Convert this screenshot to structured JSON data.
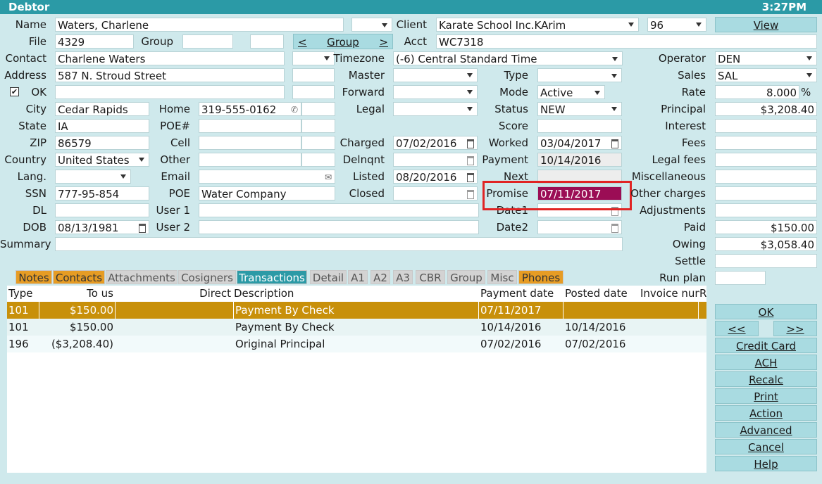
{
  "window": {
    "title": "Debtor",
    "clock": "3:27PM"
  },
  "labels": {
    "name": "Name",
    "file": "File",
    "group": "Group",
    "contact": "Contact",
    "address": "Address",
    "ok": "OK",
    "city": "City",
    "state": "State",
    "zip": "ZIP",
    "country": "Country",
    "lang": "Lang.",
    "ssn": "SSN",
    "dl": "DL",
    "dob": "DOB",
    "summary": "Summary",
    "home": "Home",
    "poe_num": "POE#",
    "cell": "Cell",
    "other": "Other",
    "email": "Email",
    "poe": "POE",
    "user1": "User 1",
    "user2": "User 2",
    "client": "Client",
    "acct": "Acct",
    "timezone": "Timezone",
    "master": "Master",
    "forward": "Forward",
    "legal": "Legal",
    "charged": "Charged",
    "delnqnt": "Delnqnt",
    "listed": "Listed",
    "closed": "Closed",
    "type": "Type",
    "mode": "Mode",
    "status": "Status",
    "score": "Score",
    "worked": "Worked",
    "payment": "Payment",
    "next": "Next",
    "promise": "Promise",
    "date1": "Date1",
    "date2": "Date2",
    "operator": "Operator",
    "sales": "Sales",
    "rate": "Rate",
    "principal": "Principal",
    "interest": "Interest",
    "fees": "Fees",
    "legal_fees": "Legal fees",
    "misc": "Miscellaneous",
    "other_charges": "Other charges",
    "adjustments": "Adjustments",
    "paid": "Paid",
    "owing": "Owing",
    "settle": "Settle",
    "run_plan": "Run plan"
  },
  "values": {
    "name": "Waters, Charlene",
    "file": "4329",
    "contact": "Charlene Waters",
    "address": "587 N. Stroud Street",
    "city": "Cedar Rapids",
    "state": "IA",
    "zip": "86579",
    "country": "United States",
    "ssn": "777-95-854",
    "dob": "08/13/1981",
    "home": "319-555-0162",
    "poe": "Water Company",
    "client": "Karate School Inc.KArim",
    "client_num": "96",
    "acct": "WC7318",
    "timezone": "(-6) Central Standard Time",
    "charged": "07/02/2016",
    "listed": "08/20/2016",
    "mode": "Active",
    "status": "NEW",
    "worked": "03/04/2017",
    "payment": "10/14/2016",
    "promise": "07/11/2017",
    "operator": "DEN",
    "sales": "SAL",
    "rate": "8.000",
    "rate_unit": "%",
    "principal": "$3,208.40",
    "paid": "$150.00",
    "owing": "$3,058.40"
  },
  "group_nav": {
    "prev": "<",
    "label": "Group",
    "next": ">"
  },
  "buttons": {
    "view": "View",
    "ok": "OK",
    "prev": "<<",
    "next": ">>",
    "credit_card": "Credit Card",
    "ach": "ACH",
    "recalc": "Recalc",
    "print": "Print",
    "action": "Action",
    "advanced": "Advanced",
    "cancel": "Cancel",
    "help": "Help"
  },
  "tabs": [
    "Notes",
    "Contacts",
    "Attachments",
    "Cosigners",
    "Transactions",
    "Detail",
    "A1",
    "A2",
    "A3",
    "CBR",
    "Group",
    "Misc",
    "Phones"
  ],
  "table": {
    "headers": [
      "Type",
      "To us",
      "Direct",
      "Description",
      "Payment date",
      "Posted date",
      "Invoice numb",
      "R"
    ],
    "rows": [
      [
        "101",
        "$150.00",
        "",
        "Payment By Check",
        "07/11/2017",
        "",
        "",
        ""
      ],
      [
        "101",
        "$150.00",
        "",
        "Payment By Check",
        "10/14/2016",
        "10/14/2016",
        "",
        ""
      ],
      [
        "196",
        "($3,208.40)",
        "",
        "Original Principal",
        "07/02/2016",
        "07/02/2016",
        "",
        ""
      ]
    ]
  },
  "colors": {
    "titlebar": "#2b9aa6",
    "background": "#cfe9ec",
    "highlight": "#9b0d55",
    "selected_row": "#c8900a",
    "tab_orange": "#e69c24",
    "tab_active": "#2b9aa6"
  }
}
